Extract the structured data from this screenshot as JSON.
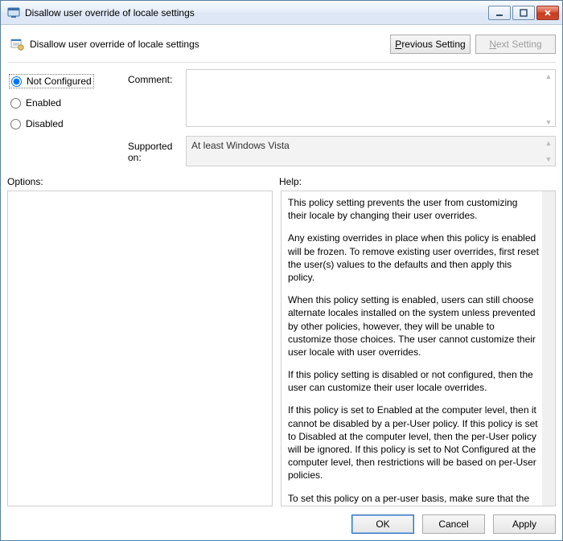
{
  "window": {
    "title": "Disallow user override of locale settings",
    "minimize_tip": "Minimize",
    "maximize_tip": "Maximize",
    "close_tip": "Close"
  },
  "header": {
    "title": "Disallow user override of locale settings",
    "prev_prefix": "P",
    "prev_rest": "revious Setting",
    "next_prefix": "N",
    "next_rest": "ext Setting"
  },
  "state": {
    "not_configured": "Not Configured",
    "enabled": "Enabled",
    "disabled": "Disabled",
    "selected": "not_configured"
  },
  "labels": {
    "comment": "Comment:",
    "supported_on": "Supported on:",
    "options": "Options:",
    "help": "Help:"
  },
  "fields": {
    "comment_value": "",
    "supported_on_value": "At least Windows Vista"
  },
  "help": {
    "p1": "This policy setting prevents the user from customizing their locale by changing their user overrides.",
    "p2": "Any existing overrides in place when this policy is enabled will be frozen. To remove existing user overrides, first reset the user(s) values to the defaults and then apply this policy.",
    "p3": "When this policy setting is enabled, users can still choose alternate locales installed on the system unless prevented by other policies, however, they will be unable to customize those choices.  The user cannot customize their user locale with user overrides.",
    "p4": "If this policy setting is disabled or not configured, then the user can customize their user locale overrides.",
    "p5": "If this policy is set to Enabled at the computer level, then it cannot be disabled by a per-User policy. If this policy is set to Disabled at the computer level, then the per-User policy will be ignored. If this policy is set to Not Configured at the computer level, then restrictions will be based on per-User policies.",
    "p6": "To set this policy on a per-user basis, make sure that the per-computer policy is set to Not Configured."
  },
  "buttons": {
    "ok": "OK",
    "cancel": "Cancel",
    "apply": "Apply"
  }
}
